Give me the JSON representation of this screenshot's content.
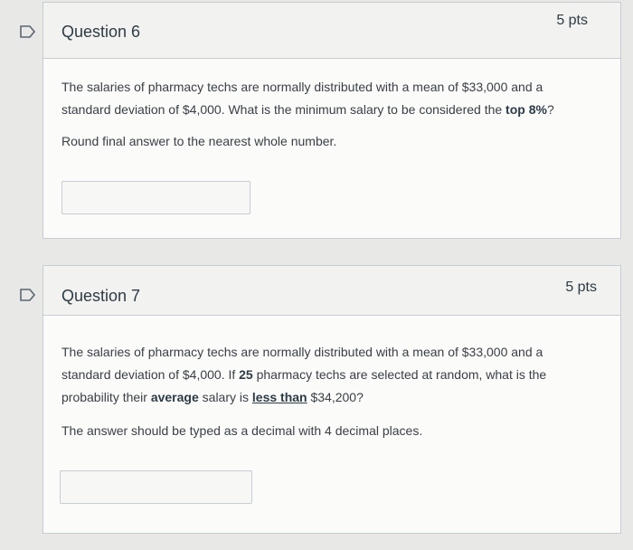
{
  "q6": {
    "title": "Question 6",
    "points": "5 pts",
    "line1": "The salaries of pharmacy techs are normally distributed with a mean of $33,000 and a",
    "line2a": "standard deviation of $4,000. What is the minimum salary to be considered the ",
    "line2b": "top 8%",
    "line2c": "?",
    "note": "Round final answer to the nearest whole number.",
    "answer_value": ""
  },
  "q7": {
    "title": "Question 7",
    "points": "5 pts",
    "line1": "The salaries of pharmacy techs are normally distributed  with a mean of $33,000 and a",
    "line2a": "standard deviation of $4,000.  If ",
    "line2b": "25",
    "line2c": " pharmacy techs are selected at random, what is the",
    "line3a": "probability their ",
    "line3b": "average",
    "line3c": " salary is ",
    "line3d": "less than",
    "line3e": " $34,200?",
    "note": "The answer should be typed as a decimal with 4 decimal places.",
    "answer_value": ""
  },
  "colors": {
    "page_bg": "#e8e8e6",
    "card_bg": "#fbfbfa",
    "header_bg": "#f2f2f0",
    "border": "#c7cdd1",
    "text": "#2d3b45"
  },
  "icons": {
    "flag": "flag-question-icon"
  }
}
